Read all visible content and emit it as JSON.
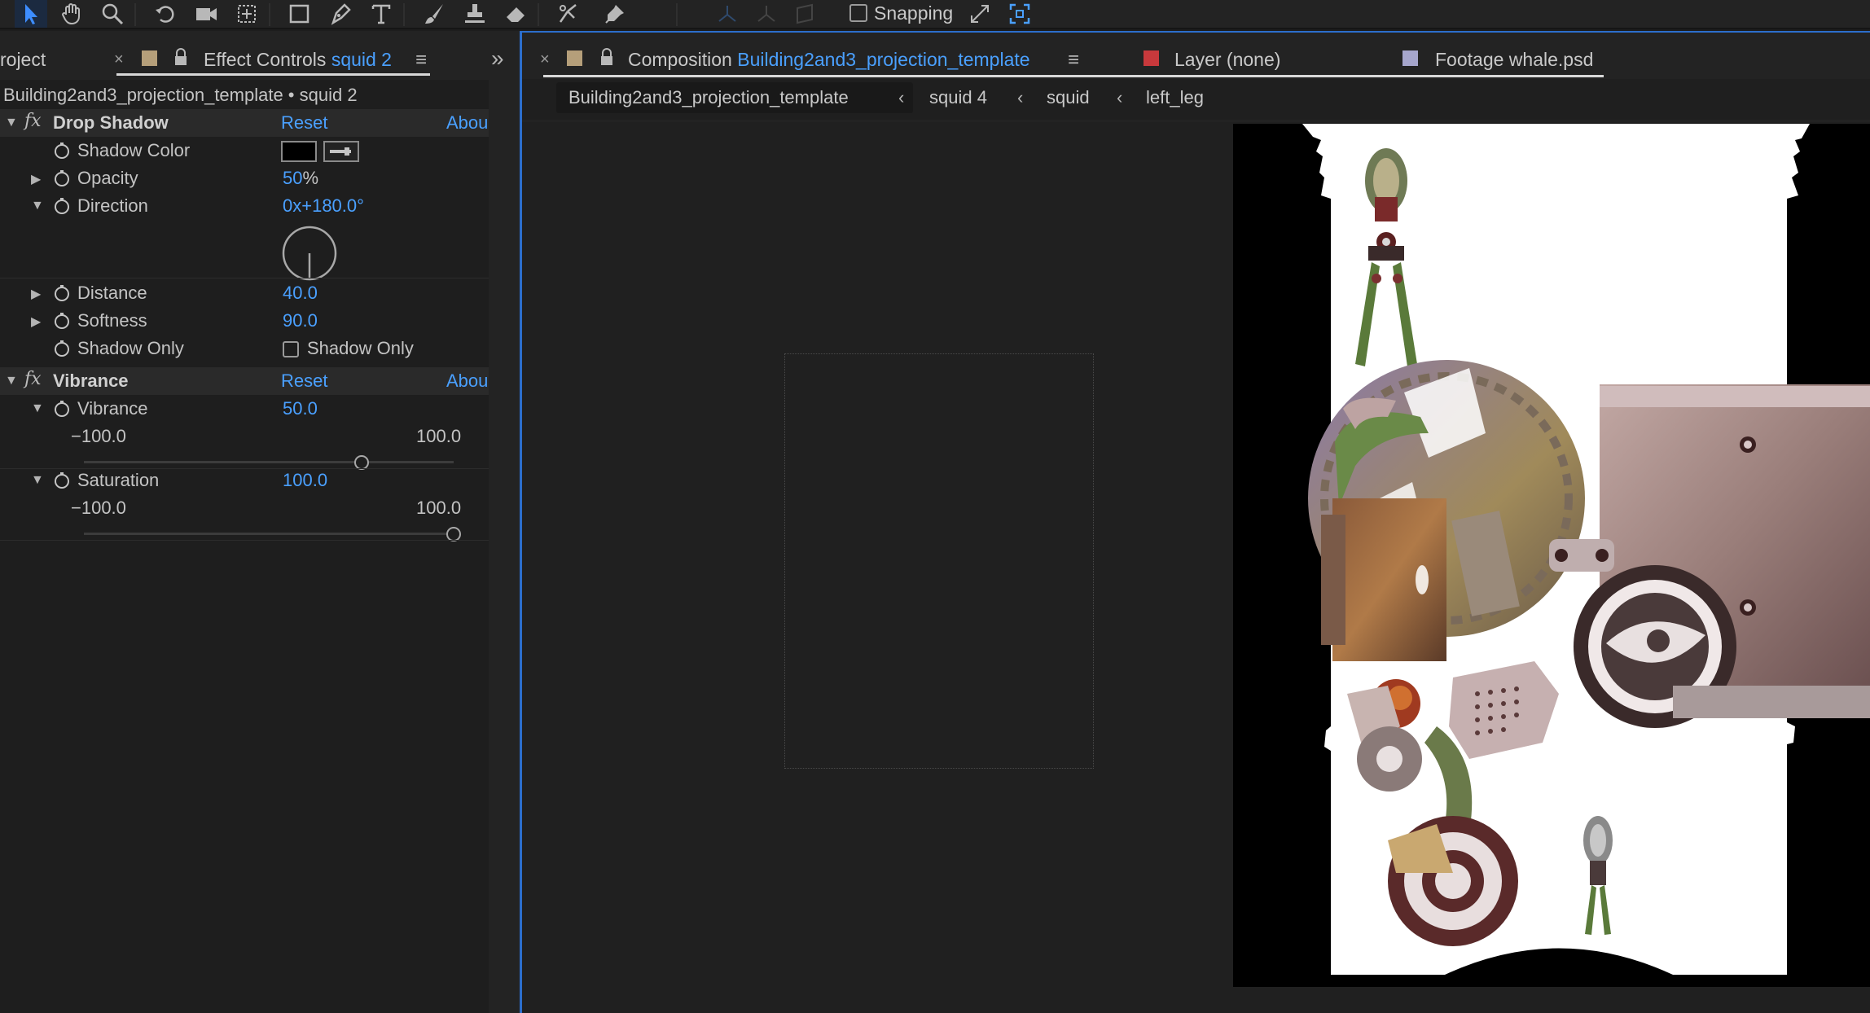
{
  "toolbar": {
    "tools": [
      {
        "icon": "selection-tool-icon"
      },
      {
        "icon": "hand-tool-icon"
      },
      {
        "icon": "zoom-tool-icon"
      },
      {
        "icon": "rotate-tool-icon"
      },
      {
        "icon": "camera-tool-icon"
      },
      {
        "icon": "pan-behind-tool-icon"
      },
      {
        "icon": "rectangle-tool-icon"
      },
      {
        "icon": "pen-tool-icon"
      },
      {
        "icon": "type-tool-icon"
      },
      {
        "icon": "brush-tool-icon"
      },
      {
        "icon": "clone-stamp-tool-icon"
      },
      {
        "icon": "eraser-tool-icon"
      },
      {
        "icon": "roto-brush-tool-icon"
      },
      {
        "icon": "puppet-pin-tool-icon"
      }
    ],
    "snapping_label": "Snapping",
    "snapping_checked": false
  },
  "left_panel": {
    "project_tab": "roject",
    "effect_controls_prefix": "Effect Controls",
    "effect_controls_layer": "squid 2",
    "breadcrumb": "Building2and3_projection_template • squid 2",
    "effects": {
      "drop_shadow": {
        "name": "Drop Shadow",
        "reset": "Reset",
        "about": "Abou",
        "shadow_color_label": "Shadow Color",
        "shadow_color": "#000000",
        "opacity_label": "Opacity",
        "opacity_value": "50",
        "opacity_unit": "%",
        "direction_label": "Direction",
        "direction_value": "0x+180.0°",
        "direction_angle": 180,
        "distance_label": "Distance",
        "distance_value": "40.0",
        "softness_label": "Softness",
        "softness_value": "90.0",
        "shadow_only_label": "Shadow Only",
        "shadow_only_checkbox_label": "Shadow Only",
        "shadow_only_checked": false
      },
      "vibrance": {
        "name": "Vibrance",
        "reset": "Reset",
        "about": "Abou",
        "vibrance_label": "Vibrance",
        "vibrance_value": "50.0",
        "vibrance_min": "−100.0",
        "vibrance_max": "100.0",
        "vibrance_fraction": 0.75,
        "saturation_label": "Saturation",
        "saturation_value": "100.0",
        "saturation_min": "−100.0",
        "saturation_max": "100.0",
        "saturation_fraction": 1.0
      }
    }
  },
  "comp_panel": {
    "comp_tab_prefix": "Composition",
    "comp_tab_name": "Building2and3_projection_template",
    "layer_tab": "Layer (none)",
    "footage_tab": "Footage whale.psd",
    "crumbs": [
      "Building2and3_projection_template",
      "squid 4",
      "squid",
      "left_leg"
    ]
  },
  "colors": {
    "accent": "#4aa0ff",
    "ec_swatch": "#b59f7a",
    "comp_swatch": "#b59f7a",
    "layer_swatch": "#c8393c",
    "footage_swatch": "#a6a6cc"
  }
}
